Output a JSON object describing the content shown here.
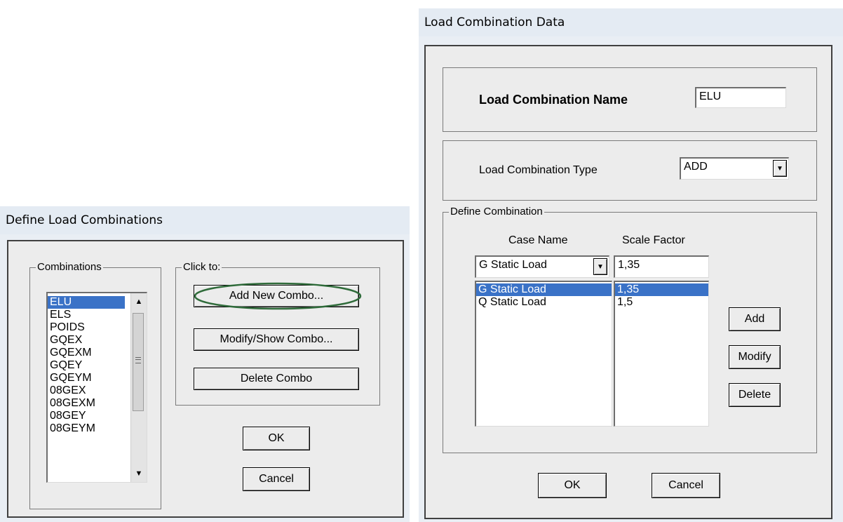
{
  "left_dialog": {
    "title": "Define Load Combinations",
    "combinations_group": "Combinations",
    "combinations": [
      "ELU",
      "ELS",
      "POIDS",
      "GQEX",
      "GQEXM",
      "GQEY",
      "GQEYM",
      "08GEX",
      "08GEXM",
      "08GEY",
      "08GEYM"
    ],
    "selected_combination": "ELU",
    "click_to_group": "Click to:",
    "add_new_combo": "Add New Combo...",
    "modify_show_combo": "Modify/Show Combo...",
    "delete_combo": "Delete Combo",
    "ok": "OK",
    "cancel": "Cancel"
  },
  "right_dialog": {
    "title": "Load Combination Data",
    "name_label": "Load Combination Name",
    "name_value": "ELU",
    "type_label": "Load Combination Type",
    "type_value": "ADD",
    "define_group": "Define Combination",
    "case_name_header": "Case Name",
    "scale_factor_header": "Scale Factor",
    "case_select_value": "G Static Load",
    "scale_input_value": "1,35",
    "rows": [
      {
        "case": "G Static Load",
        "factor": "1,35",
        "selected": true
      },
      {
        "case": "Q Static Load",
        "factor": "1,5",
        "selected": false
      }
    ],
    "add": "Add",
    "modify": "Modify",
    "delete": "Delete",
    "ok": "OK",
    "cancel": "Cancel"
  },
  "icons": {
    "scroll_up": "scroll-up-arrow",
    "scroll_down": "scroll-down-arrow",
    "dropdown": "chevron-down"
  },
  "colors": {
    "selection": "#3a72c7",
    "highlight_ellipse": "#2f6b3a"
  }
}
